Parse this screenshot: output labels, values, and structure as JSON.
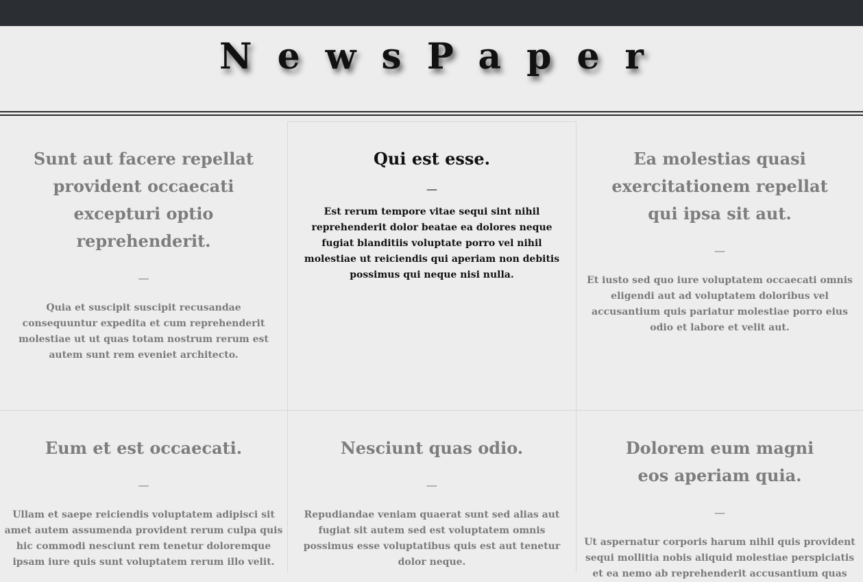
{
  "header": {
    "title": "NewsPaper"
  },
  "posts": [
    {
      "title": "Sunt aut facere repellat provident occaecati excepturi optio reprehenderit.",
      "separator": "—",
      "body": "Quia et suscipit suscipit recusandae consequuntur expedita et cum reprehenderit molestiae ut ut quas totam nostrum rerum est autem sunt rem eveniet architecto."
    },
    {
      "title": "Qui est esse.",
      "separator": "—",
      "body": "Est rerum tempore vitae sequi sint nihil reprehenderit dolor beatae ea dolores neque fugiat blanditiis voluptate porro vel nihil molestiae ut reiciendis qui aperiam non debitis possimus qui neque nisi nulla."
    },
    {
      "title": "Ea molestias quasi exercitationem repellat qui ipsa sit aut.",
      "separator": "—",
      "body": "Et iusto sed quo iure voluptatem occaecati omnis eligendi aut ad voluptatem doloribus vel accusantium quis pariatur molestiae porro eius odio et labore et velit aut."
    },
    {
      "title": "Eum et est occaecati.",
      "separator": "—",
      "body": "Ullam et saepe reiciendis voluptatem adipisci sit amet autem assumenda provident rerum culpa quis hic commodi nesciunt rem tenetur doloremque ipsam iure quis sunt voluptatem rerum illo velit."
    },
    {
      "title": "Nesciunt quas odio.",
      "separator": "—",
      "body": "Repudiandae veniam quaerat sunt sed alias aut fugiat sit autem sed est voluptatem omnis possimus esse voluptatibus quis est aut tenetur dolor neque."
    },
    {
      "title": "Dolorem eum magni eos aperiam quia.",
      "separator": "—",
      "body": "Ut aspernatur corporis harum nihil quis provident sequi mollitia nobis aliquid molestiae perspiciatis et ea nemo ab reprehenderit accusantium quas"
    }
  ],
  "colors": {
    "topbar": "#2b2e33",
    "background": "#ededed",
    "muted_text": "#7a7a7a",
    "active_text": "#111111"
  }
}
